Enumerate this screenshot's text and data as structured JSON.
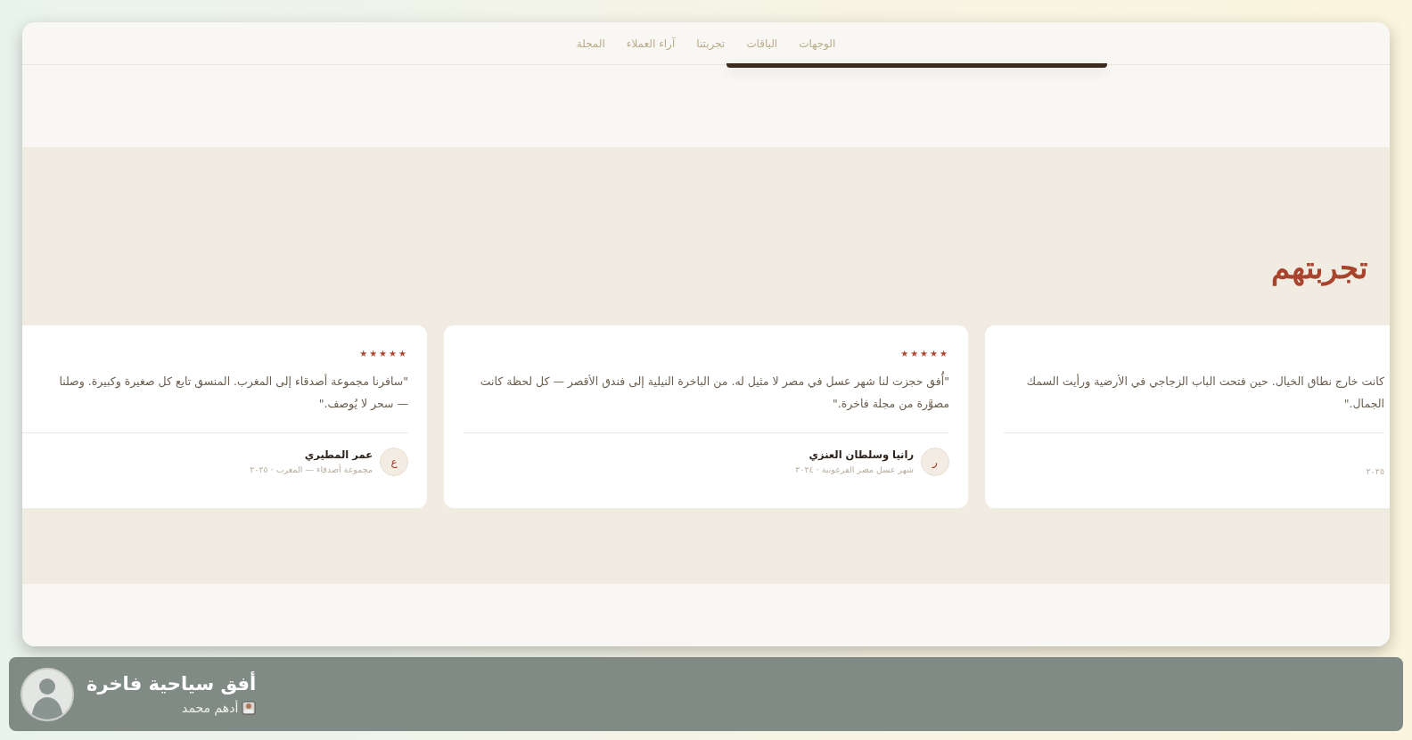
{
  "nav": {
    "links": [
      {
        "label": "الوجهات"
      },
      {
        "label": "الباقات"
      },
      {
        "label": "تجربتنا"
      },
      {
        "label": "آراء العملاء"
      },
      {
        "label": "المجلة"
      }
    ]
  },
  "testimonials": {
    "heading_accent": "تجربتهم",
    "cards": [
      {
        "quote_lines": [
          "كانت خارج نطاق الخيال. حين فتحت الباب الزجاجي في الأرضية ورأيت السمك",
          "الجمال.\""
        ],
        "meta": "٢٠٢٥"
      },
      {
        "stars": 5,
        "quote_lines": [
          "\"أُفق حجزت لنا شهر عسل في مصر لا مثيل له. من الباخرة النيلية إلى فندق الأقصر — كل لحظة كانت",
          "مصوَّرة من مجلة فاخرة.\""
        ],
        "avatar": "ر",
        "name": "رانيا وسلطان العنزي",
        "meta": "شهر عسل مصر الفرعونية · ٢٠٢٤"
      },
      {
        "stars": 5,
        "quote_lines": [
          "\"سافرنا مجموعة أصدقاء إلى المغرب. المنسق تابع كل صغيرة وكبيرة. وصلنا",
          "— سحر لا يُوصف.\""
        ],
        "avatar": "ع",
        "name": "عمر المطيري",
        "meta": "مجموعة أصدقاء — المغرب · ٢٠٢٥"
      }
    ]
  },
  "showcase": {
    "title": "أفق سياحية فاخرة",
    "author": "أدهم محمد"
  }
}
